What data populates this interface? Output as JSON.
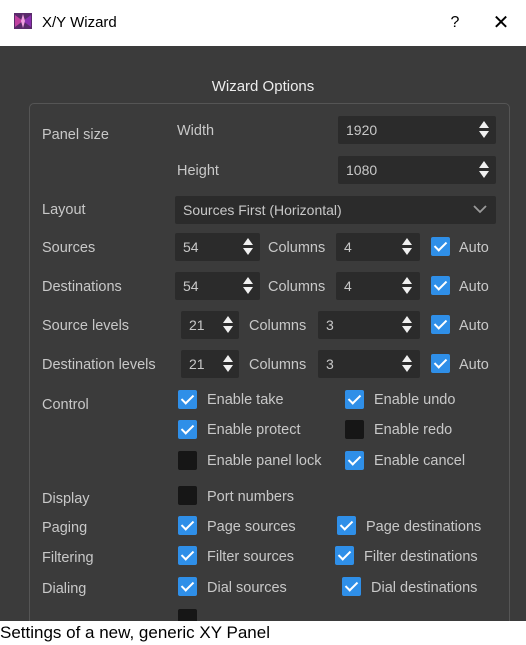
{
  "window": {
    "title": "X/Y Wizard",
    "help": "?",
    "close": "✕"
  },
  "dialog": {
    "heading": "Wizard Options"
  },
  "panel_size": {
    "label": "Panel size",
    "width_label": "Width",
    "width_value": "1920",
    "height_label": "Height",
    "height_value": "1080"
  },
  "layout": {
    "label": "Layout",
    "value": "Sources First (Horizontal)"
  },
  "sources": {
    "label": "Sources",
    "value": "54",
    "columns_label": "Columns",
    "columns_value": "4",
    "auto_label": "Auto",
    "auto": true
  },
  "destinations": {
    "label": "Destinations",
    "value": "54",
    "columns_label": "Columns",
    "columns_value": "4",
    "auto_label": "Auto",
    "auto": true
  },
  "source_levels": {
    "label": "Source levels",
    "value": "21",
    "columns_label": "Columns",
    "columns_value": "3",
    "auto_label": "Auto",
    "auto": true
  },
  "destination_levels": {
    "label": "Destination levels",
    "value": "21",
    "columns_label": "Columns",
    "columns_value": "3",
    "auto_label": "Auto",
    "auto": true
  },
  "control": {
    "label": "Control",
    "enable_take": {
      "label": "Enable take",
      "checked": true
    },
    "enable_undo": {
      "label": "Enable undo",
      "checked": true
    },
    "enable_protect": {
      "label": "Enable protect",
      "checked": true
    },
    "enable_redo": {
      "label": "Enable redo",
      "checked": false
    },
    "enable_panel_lock": {
      "label": "Enable panel lock",
      "checked": false
    },
    "enable_cancel": {
      "label": "Enable cancel",
      "checked": true
    }
  },
  "display": {
    "label": "Display",
    "port_numbers": {
      "label": "Port numbers",
      "checked": false
    }
  },
  "paging": {
    "label": "Paging",
    "page_sources": {
      "label": "Page sources",
      "checked": true
    },
    "page_destinations": {
      "label": "Page destinations",
      "checked": true
    }
  },
  "filtering": {
    "label": "Filtering",
    "filter_sources": {
      "label": "Filter sources",
      "checked": true
    },
    "filter_destinations": {
      "label": "Filter destinations",
      "checked": true
    }
  },
  "dialing": {
    "label": "Dialing",
    "dial_sources": {
      "label": "Dial sources",
      "checked": true
    },
    "dial_destinations": {
      "label": "Dial destinations",
      "checked": true
    }
  },
  "caption": "Settings of a new, generic XY Panel",
  "colors": {
    "dialog_bg": "#3b3b3b",
    "field_bg": "#2b2b2b",
    "check_accent": "#2f8fe8",
    "text": "#c8c8c8"
  },
  "icons": {
    "app": "xy-wizard-app-icon",
    "help": "help-icon",
    "close": "close-icon",
    "dropdown": "chevron-down-icon",
    "spin": "spin-arrows-icon"
  }
}
